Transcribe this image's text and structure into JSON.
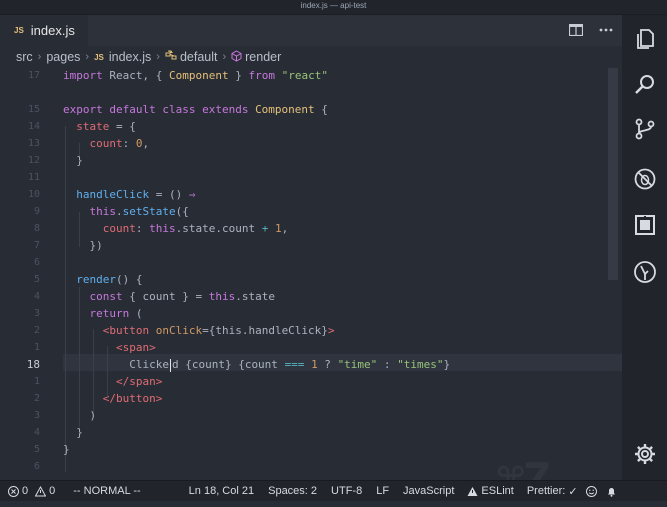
{
  "window": {
    "title": "index.js — api-test"
  },
  "tab": {
    "badge": "JS",
    "label": "index.js"
  },
  "breadcrumbs": [
    {
      "label": "src",
      "icon": "none"
    },
    {
      "label": "pages",
      "icon": "none"
    },
    {
      "label": "index.js",
      "icon": "js-file-icon",
      "badge": "JS"
    },
    {
      "label": "default",
      "icon": "class-icon"
    },
    {
      "label": "render",
      "icon": "method-icon"
    }
  ],
  "editor": {
    "current_line": "18",
    "line_numbers": [
      "17",
      "",
      "15",
      "14",
      "13",
      "12",
      "11",
      "10",
      "9",
      "8",
      "7",
      "6",
      "5",
      "4",
      "3",
      "2",
      "1",
      "18",
      "1",
      "2",
      "3",
      "4",
      "5",
      "6"
    ],
    "code_lines": [
      [
        [
          "kw",
          "import "
        ],
        [
          "plain",
          "React, { "
        ],
        [
          "cls",
          "Component"
        ],
        [
          "plain",
          " } "
        ],
        [
          "kw",
          "from "
        ],
        [
          "str",
          "\"react\""
        ]
      ],
      [],
      [
        [
          "kw",
          "export default class "
        ],
        [
          "kw",
          "extends "
        ],
        [
          "cls",
          "Component"
        ],
        [
          "plain",
          " {"
        ]
      ],
      [
        [
          "plain",
          "  "
        ],
        [
          "var",
          "state"
        ],
        [
          "plain",
          " = {"
        ]
      ],
      [
        [
          "plain",
          "    "
        ],
        [
          "var",
          "count"
        ],
        [
          "plain",
          ": "
        ],
        [
          "num",
          "0"
        ],
        [
          "plain",
          ","
        ]
      ],
      [
        [
          "plain",
          "  }"
        ]
      ],
      [],
      [
        [
          "plain",
          "  "
        ],
        [
          "fn",
          "handleClick"
        ],
        [
          "plain",
          " = () "
        ],
        [
          "kw",
          "⇒"
        ]
      ],
      [
        [
          "plain",
          "    "
        ],
        [
          "kw",
          "this"
        ],
        [
          "plain",
          "."
        ],
        [
          "fn",
          "setState"
        ],
        [
          "plain",
          "({"
        ]
      ],
      [
        [
          "plain",
          "      "
        ],
        [
          "var",
          "count"
        ],
        [
          "plain",
          ": "
        ],
        [
          "kw",
          "this"
        ],
        [
          "plain",
          ".state.count "
        ],
        [
          "op",
          "+"
        ],
        [
          "plain",
          " "
        ],
        [
          "num",
          "1"
        ],
        [
          "plain",
          ","
        ]
      ],
      [
        [
          "plain",
          "    })"
        ]
      ],
      [],
      [
        [
          "plain",
          "  "
        ],
        [
          "fn",
          "render"
        ],
        [
          "plain",
          "() {"
        ]
      ],
      [
        [
          "plain",
          "    "
        ],
        [
          "kw",
          "const"
        ],
        [
          "plain",
          " { count } = "
        ],
        [
          "kw",
          "this"
        ],
        [
          "plain",
          ".state"
        ]
      ],
      [
        [
          "plain",
          "    "
        ],
        [
          "kw",
          "return"
        ],
        [
          "plain",
          " ("
        ]
      ],
      [
        [
          "plain",
          "      "
        ],
        [
          "tag",
          "<button "
        ],
        [
          "attr",
          "onClick"
        ],
        [
          "plain",
          "={this.handleClick}"
        ],
        [
          "tag",
          ">"
        ]
      ],
      [
        [
          "plain",
          "        "
        ],
        [
          "tag",
          "<span>"
        ]
      ],
      [
        [
          "plain",
          "          Clicke"
        ],
        [
          "cursor",
          ""
        ],
        [
          "plain",
          "d {count} {count "
        ],
        [
          "op",
          "==="
        ],
        [
          "plain",
          " "
        ],
        [
          "num",
          "1"
        ],
        [
          "plain",
          " ? "
        ],
        [
          "str",
          "\"time\""
        ],
        [
          "plain",
          " : "
        ],
        [
          "str",
          "\"times\""
        ],
        [
          "plain",
          "}"
        ]
      ],
      [
        [
          "plain",
          "        "
        ],
        [
          "tag",
          "</span>"
        ]
      ],
      [
        [
          "plain",
          "      "
        ],
        [
          "tag",
          "</button>"
        ]
      ],
      [
        [
          "plain",
          "    )"
        ]
      ],
      [
        [
          "plain",
          "  }"
        ]
      ],
      [
        [
          "plain",
          "}"
        ]
      ],
      []
    ],
    "watermark": "⌘Z"
  },
  "activity_bar": [
    "files-icon",
    "search-icon",
    "source-control-icon",
    "debug-icon",
    "extensions-icon",
    "git-lens-icon",
    "settings-gear-icon"
  ],
  "status_bar": {
    "errors": "0",
    "warnings": "0",
    "mode": "-- NORMAL --",
    "position": "Ln 18, Col 21",
    "spaces": "Spaces: 2",
    "encoding": "UTF-8",
    "eol": "LF",
    "language": "JavaScript",
    "eslint": "ESLint",
    "prettier": "Prettier:",
    "prettier_status": "✓"
  },
  "colors": {
    "background": "#282c34",
    "sidebar": "#21252b",
    "keyword": "#c678dd",
    "string": "#98c379",
    "number": "#d19a66",
    "function": "#61afef",
    "class": "#e5c07b"
  }
}
